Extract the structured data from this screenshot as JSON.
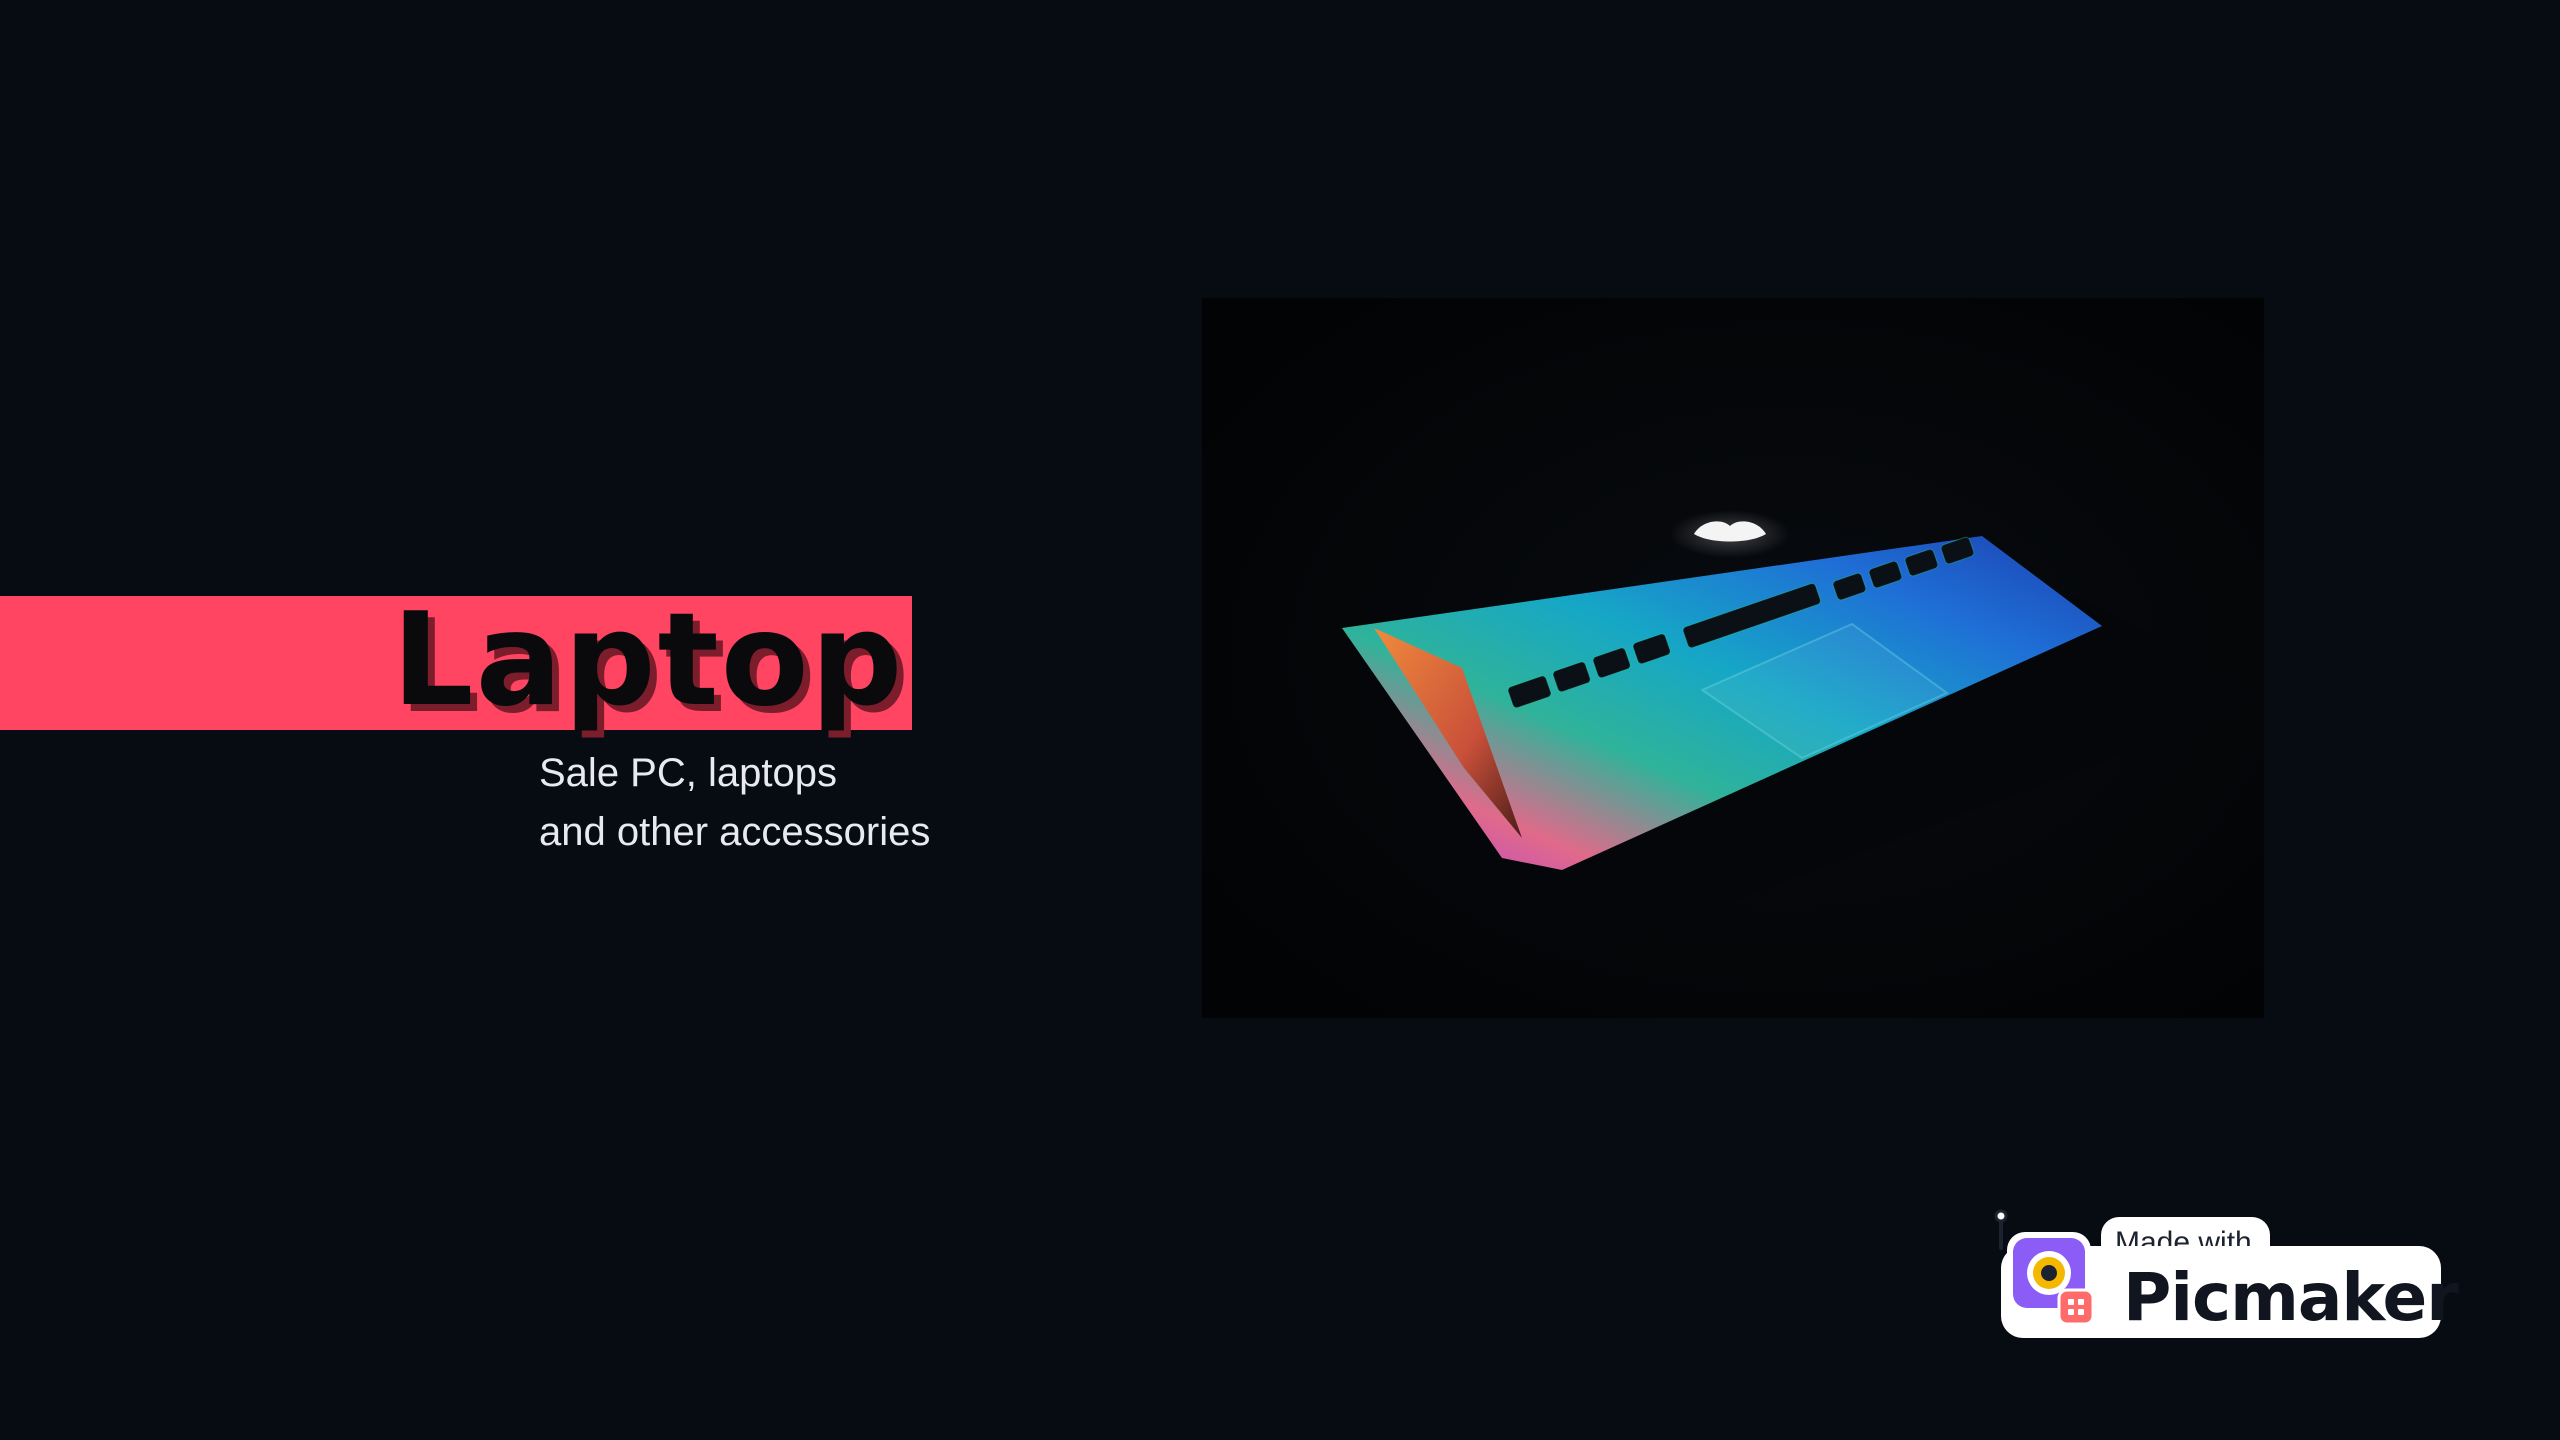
{
  "hero": {
    "title": "Laptop",
    "subtitle_line1": "Sale PC, laptops",
    "subtitle_line2": "and other accessories"
  },
  "badge": {
    "made_with": "Made with",
    "brand": "Picmaker"
  },
  "colors": {
    "background": "#070b12",
    "accent": "#ff4561",
    "title_text": "#0a0a0d",
    "subtitle_text": "#e8eaee",
    "badge_purple": "#8b5cf6",
    "badge_coral": "#ff6b6b"
  },
  "image": {
    "subject": "laptop-keyboard-rainbow-glow"
  }
}
